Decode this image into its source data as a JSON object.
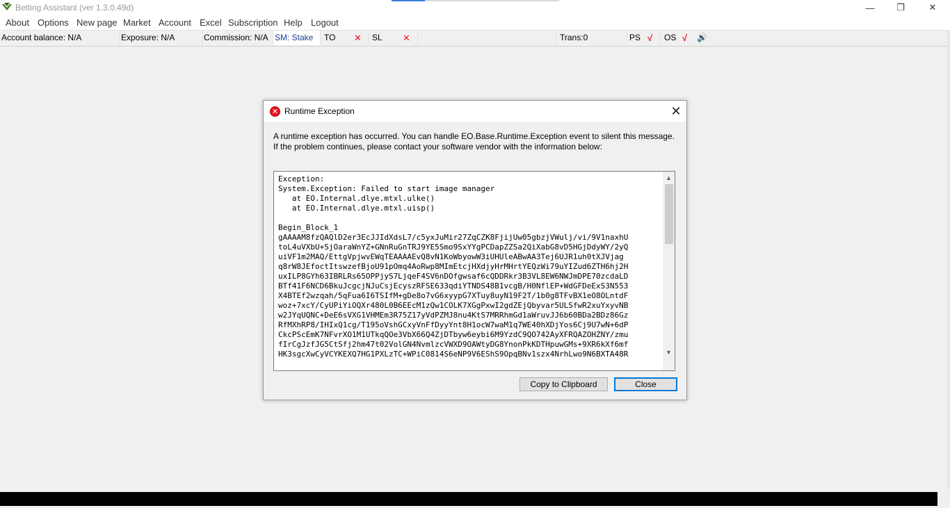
{
  "window": {
    "title": "Betting Assistant (ver 1.3.0.49d)",
    "minimize_glyph": "—",
    "maximize_glyph": "❐",
    "close_glyph": "✕"
  },
  "menu": [
    "About",
    "Options",
    "New page",
    "Market",
    "Account",
    "Excel",
    "Subscription",
    "Help",
    "Logout"
  ],
  "status": {
    "account_balance": "Account balance: N/A",
    "exposure": "Exposure: N/A",
    "commission": "Commission: N/A",
    "stake_mode": "SM: Stake",
    "to_label": "TO",
    "sl_label": "SL",
    "x_glyph": "✕",
    "trans": "Trans:0",
    "ps_label": "PS",
    "os_label": "OS",
    "check_glyph": "√",
    "speaker_glyph": "🔊"
  },
  "dialog": {
    "title": "Runtime Exception",
    "error_glyph": "✕",
    "close_glyph": "✕",
    "message": "A runtime exception has occurred. You can handle EO.Base.Runtime.Exception event to silent this message. If the problem continues, please contact your software vendor with the information below:",
    "details": "Exception:\nSystem.Exception: Failed to start image manager\n   at EO.Internal.dlye.mtxl.ulke()\n   at EO.Internal.dlye.mtxl.uisp()\n\nBegin_Block_1\ngAAAAM8fzQAQlD2er3EcJJIdXdsL7/c5yxJuMir27ZqCZK8FjijUw05gbzjVWulj/vi/9V1naxhU\ntoL4uVXbU+SjOaraWnYZ+GNnRuGnTRJ9YE5Smo9SxYYgPCDapZZSa2QiXabG8vD5HGjDdyWY/2yQ\nuiVF1m2MAQ/EttgVpjwvEWqTEAAAAEvQ8vN1KoWbyowW3iUHUleABwAA3Tej6UJR1uh0tXJVjag\nq8rW8JEfoctItswzefBjoU91pOmq4AoRwp8MImEtcjHXdjyHrMHrtYEQzWi79uYIZud6ZTH6hj2H\nuxILP8GYh63IBRLRs65OPPjyS7LjqeF4SV6nDOfgwsaf6cQDDRkr3B3VL8EW6NWJmDPE70zcdaLD\nBTf41F6NCD6BkuJcgcjNJuCsjEcyszRFSE633qdiYTNDS48B1vcgB/H0NflEP+WdGFDeExS3N553\nX4BTEf2wzqah/5qFua6I6TSIfM+gDe8o7vG6xyypG7XTuy8uyN19F2T/1b0g8TFvBX1eO8OLntdF\nwoz+7xcY/CyUPiYiOQXr480L0B6EEcM1zQw1COLK7XGgPxwI2gdZEjQbyvar5ULSfwR2xuYxyvNB\nw2JYqUQNC+DeE6sVXG1VHMEm3R75Z17yVdPZMJ8nu4KtS7MRRhmGd1aWruvJJ6b60BDa2BDz86Gz\nRfMXhRP8/IHIxQ1cg/T195oVshGCxyVnFfDyyYnt8H1ocW7waM1q7WE40hXDjYos6Cj9U7wN+6dP\nCkcPScEmK7NFvrXO1M1UTkqQOe3VbX66Q4ZjDTbyw6eybi6M9YzdC9QO742AyXFRQAZOHZNY/zmu\nfIrCgJzfJG5CtSfj2hm47t02VolGN4NvmlzcVWXD9OAWtyDG8YnonPkKDTHpuwGMs+9XR6kXf6mf\nHK3sgcXwCyVCYKEXQ7HG1PXLzTC+WPiC0814S6eNP9V6EShS9OpqBNv1szx4NrhLwo9N6BXTA48R",
    "copy_button": "Copy to Clipboard",
    "close_button": "Close",
    "scroll_up_glyph": "▲",
    "scroll_down_glyph": "▼"
  }
}
